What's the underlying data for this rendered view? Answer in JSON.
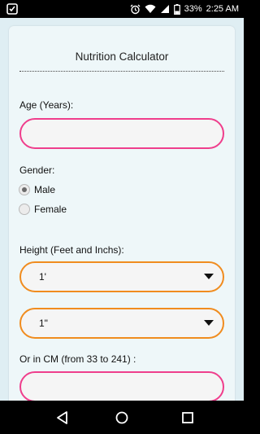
{
  "status_bar": {
    "battery": "33%",
    "time": "2:25 AM"
  },
  "app": {
    "title": "Nutrition Calculator"
  },
  "form": {
    "age_label": "Age (Years):",
    "gender_label": "Gender:",
    "gender_options": [
      "Male",
      "Female"
    ],
    "gender_selected": "Male",
    "height_label": "Height (Feet and Inchs):",
    "feet_value": "1'",
    "inches_value": "1\"",
    "cm_label": "Or in CM (from 33 to 241) :"
  },
  "colors": {
    "input_border": "#ef3e8c",
    "select_border": "#f08c1f"
  },
  "icons": {
    "status_left": "app-notification-icon",
    "nav": [
      "back-icon",
      "home-icon",
      "recents-icon"
    ]
  }
}
